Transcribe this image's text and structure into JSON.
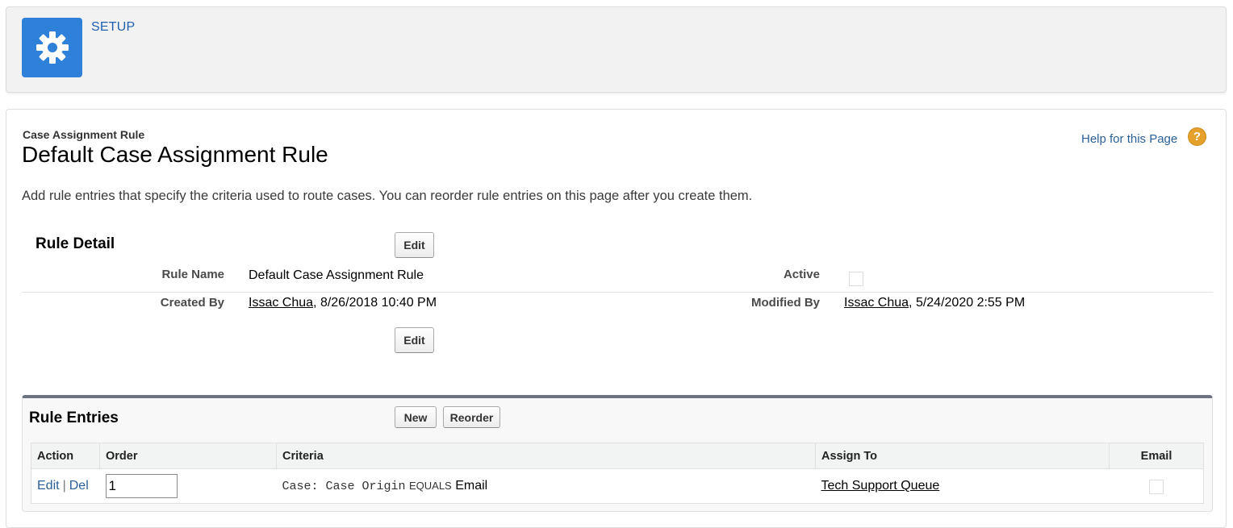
{
  "header": {
    "title": "SETUP",
    "icon": "gear-icon",
    "icon_bg": "#2f80d8"
  },
  "page": {
    "type": "Case Assignment Rule",
    "title": "Default Case Assignment Rule",
    "help_link": "Help for this Page",
    "help_icon_glyph": "?",
    "description": "Add rule entries that specify the criteria used to route cases. You can reorder rule entries on this page after you create them."
  },
  "rule_detail": {
    "section_title": "Rule Detail",
    "edit_label": "Edit",
    "fields": {
      "rule_name_label": "Rule Name",
      "rule_name_value": "Default Case Assignment Rule",
      "active_label": "Active",
      "active_checked": false,
      "created_by_label": "Created By",
      "created_by_user": "Issac Chua",
      "created_by_date": ", 8/26/2018 10:40 PM",
      "modified_by_label": "Modified By",
      "modified_by_user": "Issac Chua",
      "modified_by_date": ", 5/24/2020 2:55 PM"
    }
  },
  "rule_entries": {
    "section_title": "Rule Entries",
    "new_label": "New",
    "reorder_label": "Reorder",
    "columns": [
      "Action",
      "Order",
      "Criteria",
      "Assign To",
      "Email"
    ],
    "rows": [
      {
        "action_edit": "Edit",
        "action_sep": "|",
        "action_del": "Del",
        "order": "1",
        "criteria_field": "Case: Case Origin",
        "criteria_operator": "EQUALS",
        "criteria_value": "Email",
        "assign_to": "Tech Support Queue",
        "email_checked": false
      }
    ]
  }
}
